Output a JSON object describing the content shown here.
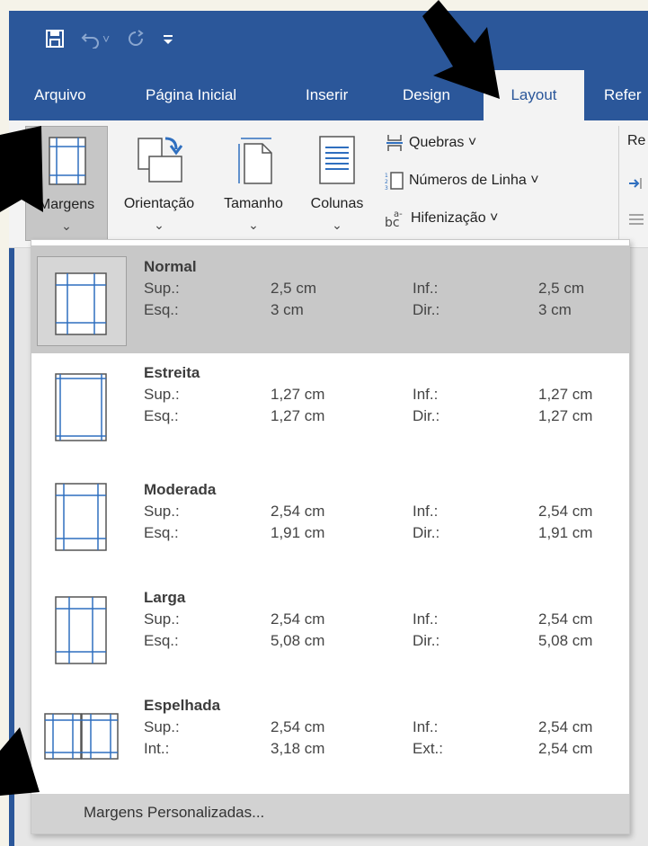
{
  "quick_access": {
    "icons": [
      "save-icon",
      "undo-icon",
      "redo-icon",
      "customize-icon"
    ],
    "undo_caret": "˅"
  },
  "tabs": [
    {
      "label": "Arquivo"
    },
    {
      "label": "Página Inicial"
    },
    {
      "label": "Inserir"
    },
    {
      "label": "Design"
    },
    {
      "label": "Layout",
      "active": true
    },
    {
      "label": "Refer"
    }
  ],
  "ribbon": {
    "buttons": [
      {
        "label": "Margens",
        "icon": "margins-icon",
        "pressed": true
      },
      {
        "label": "Orientação",
        "icon": "orientation-icon"
      },
      {
        "label": "Tamanho",
        "icon": "size-icon"
      },
      {
        "label": "Colunas",
        "icon": "columns-icon"
      }
    ],
    "chevron": "⌄",
    "small": [
      {
        "label": "Quebras ˅",
        "icon": "breaks-icon"
      },
      {
        "label": "Números de Linha ˅",
        "icon": "line-numbers-icon"
      },
      {
        "label": "Hifenização ˅",
        "icon": "hyphenation-icon"
      }
    ],
    "next_group_label": "Re"
  },
  "margins_menu": {
    "options": [
      {
        "name": "Normal",
        "selected": true,
        "rows": [
          [
            "Sup.:",
            "2,5 cm",
            "Inf.:",
            "2,5 cm"
          ],
          [
            "Esq.:",
            "3 cm",
            "Dir.:",
            "3 cm"
          ]
        ]
      },
      {
        "name": "Estreita",
        "rows": [
          [
            "Sup.:",
            "1,27 cm",
            "Inf.:",
            "1,27 cm"
          ],
          [
            "Esq.:",
            "1,27 cm",
            "Dir.:",
            "1,27 cm"
          ]
        ]
      },
      {
        "name": "Moderada",
        "rows": [
          [
            "Sup.:",
            "2,54 cm",
            "Inf.:",
            "2,54 cm"
          ],
          [
            "Esq.:",
            "1,91 cm",
            "Dir.:",
            "1,91 cm"
          ]
        ]
      },
      {
        "name": "Larga",
        "rows": [
          [
            "Sup.:",
            "2,54 cm",
            "Inf.:",
            "2,54 cm"
          ],
          [
            "Esq.:",
            "5,08 cm",
            "Dir.:",
            "5,08 cm"
          ]
        ]
      },
      {
        "name": "Espelhada",
        "rows": [
          [
            "Sup.:",
            "2,54 cm",
            "Inf.:",
            "2,54 cm"
          ],
          [
            "Int.:",
            "3,18 cm",
            "Ext.:",
            "2,54 cm"
          ]
        ]
      }
    ],
    "custom_label": "Margens Personalizadas..."
  },
  "colors": {
    "title_bar": "#2b579a",
    "ribbon_bg": "#f3f3f3",
    "selected_item": "#c8c8c8",
    "thumbnail_lines": "#2f6fbf",
    "annotation_arrows": "#000000"
  }
}
